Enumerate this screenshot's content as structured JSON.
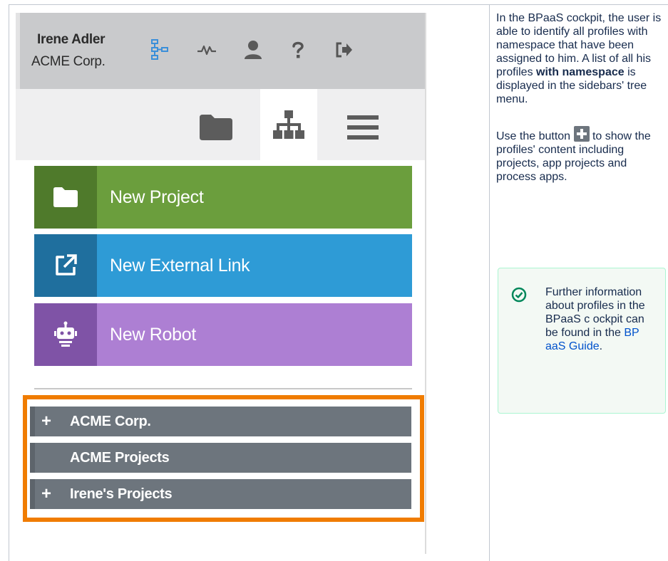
{
  "user": {
    "name": "Irene Adler",
    "company": "ACME Corp."
  },
  "toolbar_icons": [
    "diagram-icon",
    "activity-icon",
    "user-icon",
    "help-icon",
    "logout-icon"
  ],
  "tabs": [
    "folder-icon",
    "tree-icon",
    "menu-icon"
  ],
  "actions": [
    {
      "label": "New Project",
      "icon": "folder-icon",
      "color": "#6b9e3d",
      "icon_bg": "#4f7a2b"
    },
    {
      "label": "New External Link",
      "icon": "external-link-icon",
      "color": "#2e9bd6",
      "icon_bg": "#1f6f9e"
    },
    {
      "label": "New Robot",
      "icon": "robot-icon",
      "color": "#ad7fd3",
      "icon_bg": "#7f53a6"
    }
  ],
  "tree": [
    {
      "label": "ACME Corp.",
      "expand": "+"
    },
    {
      "label": "ACME Projects",
      "expand": ""
    },
    {
      "label": "Irene's Projects",
      "expand": "+"
    }
  ],
  "highlight_color": "#f07c00",
  "description": {
    "p1_before": "In the BPaaS cockpit, the user is able to identify all profiles with namespace that have been assigned to him. A list of all his profiles ",
    "p1_bold": "with namespace",
    "p1_after": " is displayed in the sidebars' tree menu.",
    "p2_before": "Use the button ",
    "p2_after": " to show the profiles' content including projects, app projects and process apps."
  },
  "info": {
    "text_before": "Further information about profiles in the BPaaS c ockpit can be found in the ",
    "link": "BP aaS Guide",
    "text_after": "."
  }
}
